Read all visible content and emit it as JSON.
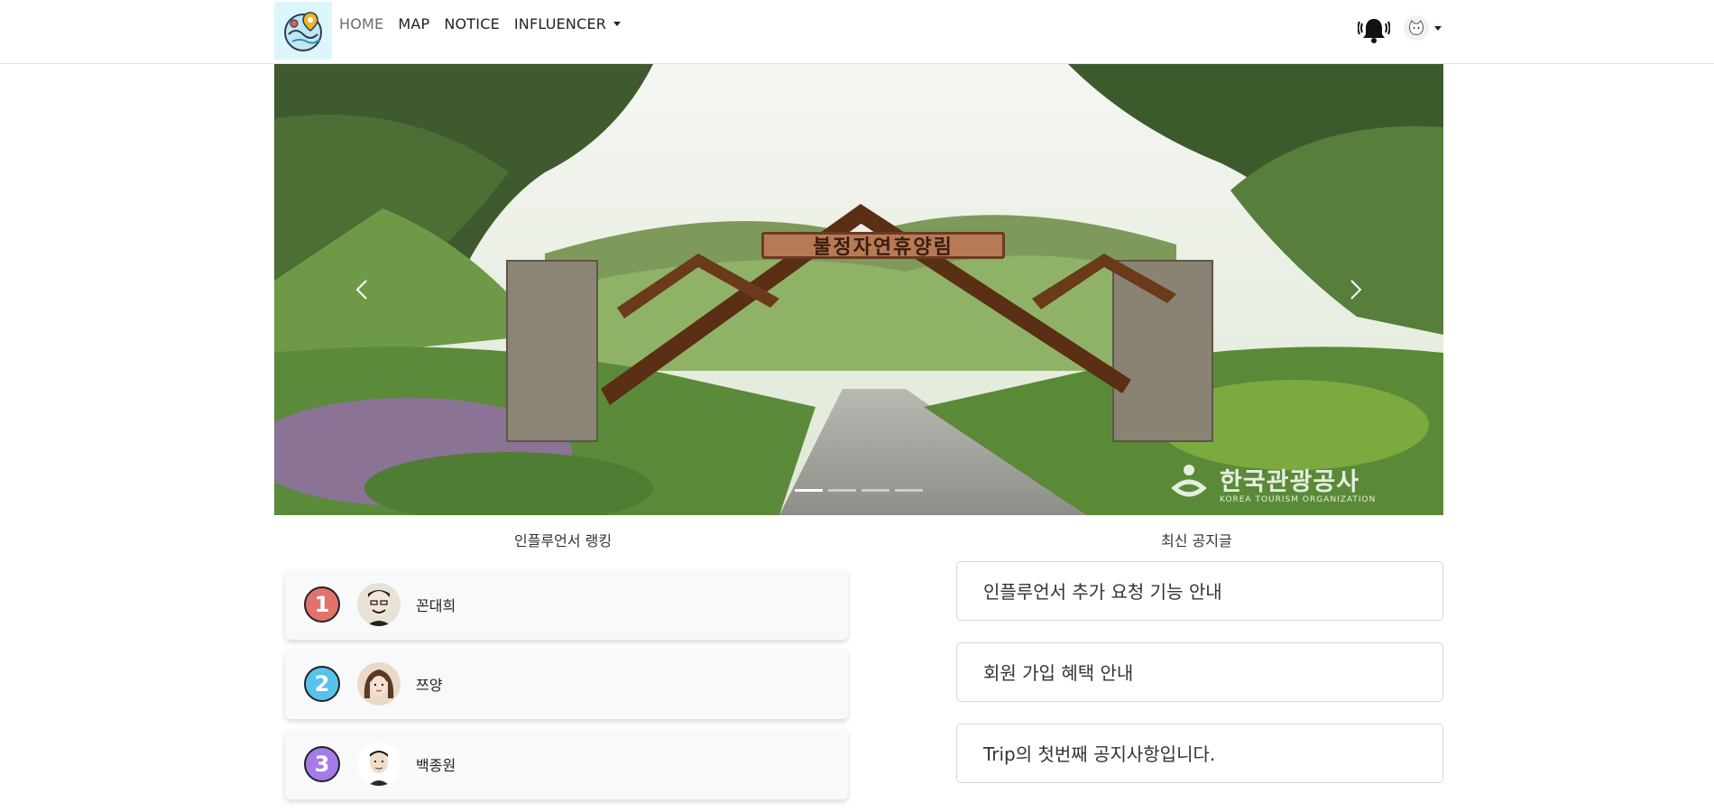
{
  "nav": {
    "links": [
      {
        "label": "HOME"
      },
      {
        "label": "MAP"
      },
      {
        "label": "NOTICE"
      },
      {
        "label": "INFLUENCER"
      }
    ]
  },
  "carousel": {
    "slide_count": 4,
    "active_index": 0,
    "sign_text": "불정자연휴양림",
    "watermark": "한국관광공사",
    "watermark_sub": "KOREA TOURISM ORGANIZATION"
  },
  "ranking": {
    "title": "인플루언서 랭킹",
    "items": [
      {
        "rank": "1",
        "name": "꼰대희",
        "color": "#e0736b"
      },
      {
        "rank": "2",
        "name": "쯔양",
        "color": "#55c3ec"
      },
      {
        "rank": "3",
        "name": "백종원",
        "color": "#a67ae8"
      }
    ]
  },
  "notices": {
    "title": "최신 공지글",
    "items": [
      {
        "text": "인플루언서 추가 요청 기능 안내"
      },
      {
        "text": "회원 가입 혜택 안내"
      },
      {
        "text": "Trip의 첫번째 공지사항입니다."
      }
    ]
  },
  "colors": {
    "logo_bg": "#dcf6fb",
    "card_bg": "#f8f9fa"
  },
  "icons": [
    "logo-icon",
    "bell-icon",
    "avatar-icon",
    "chevron-left-icon",
    "chevron-right-icon"
  ]
}
